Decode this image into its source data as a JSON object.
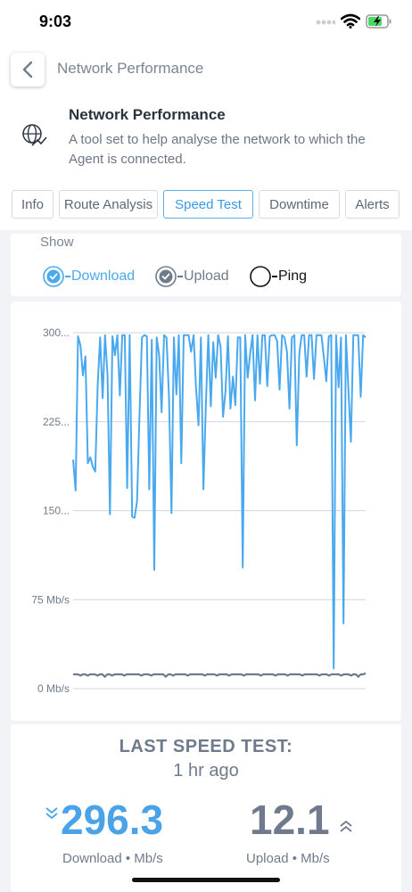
{
  "status_bar": {
    "time": "9:03"
  },
  "nav": {
    "title": "Network Performance"
  },
  "header": {
    "title": "Network Performance",
    "description": "A tool set to help analyse the network to which the Agent is connected."
  },
  "tabs": [
    {
      "label": "Info",
      "active": false
    },
    {
      "label": "Route Analysis",
      "active": false
    },
    {
      "label": "Speed Test",
      "active": true
    },
    {
      "label": "Downtime",
      "active": false
    },
    {
      "label": "Alerts",
      "active": false
    }
  ],
  "show": {
    "label": "Show",
    "toggles": [
      {
        "label": "Download",
        "checked": true
      },
      {
        "label": "Upload",
        "checked": true
      },
      {
        "label": "Ping",
        "checked": false
      }
    ]
  },
  "colors": {
    "download": "#4aa9ee",
    "upload": "#6f7b8c",
    "accent": "#3a9ae6"
  },
  "chart_data": {
    "type": "line",
    "ylim": [
      0,
      300
    ],
    "yticks": [
      {
        "value": 0,
        "label": "0 Mb/s"
      },
      {
        "value": 75,
        "label": "75 Mb/s"
      },
      {
        "value": 150,
        "label": "150..."
      },
      {
        "value": 225,
        "label": "225..."
      },
      {
        "value": 300,
        "label": "300..."
      }
    ],
    "grid": true,
    "series": [
      {
        "name": "Download",
        "values": [
          193,
          167,
          297,
          289,
          264,
          280,
          190,
          195,
          187,
          183,
          257,
          296,
          245,
          298,
          264,
          147,
          297,
          281,
          298,
          247,
          298,
          298,
          169,
          298,
          145,
          144,
          158,
          230,
          296,
          298,
          297,
          168,
          294,
          100,
          296,
          281,
          233,
          298,
          296,
          246,
          148,
          296,
          248,
          298,
          190,
          298,
          298,
          298,
          284,
          298,
          254,
          222,
          296,
          168,
          238,
          298,
          238,
          292,
          262,
          298,
          288,
          229,
          251,
          297,
          236,
          263,
          239,
          296,
          296,
          102,
          298,
          262,
          282,
          298,
          243,
          298,
          257,
          298,
          298,
          255,
          297,
          298,
          298,
          293,
          252,
          298,
          296,
          284,
          236,
          296,
          298,
          205,
          282,
          298,
          298,
          263,
          298,
          298,
          261,
          298,
          298,
          298,
          280,
          259,
          297,
          298,
          17,
          298,
          254,
          296,
          55,
          298,
          252,
          208,
          298,
          298,
          298,
          246,
          298,
          296
        ]
      },
      {
        "name": "Upload",
        "values": [
          12,
          12,
          12,
          11,
          12,
          12,
          11,
          12,
          12,
          12,
          11,
          12,
          12,
          10,
          12,
          12,
          11,
          12,
          12,
          12,
          12,
          11,
          12,
          12,
          12,
          12,
          12,
          12,
          11,
          12,
          12,
          12,
          11,
          12,
          12,
          12,
          12,
          12,
          10,
          12,
          12,
          11,
          12,
          12,
          12,
          12,
          12,
          11,
          12,
          12,
          12,
          12,
          12,
          12,
          11,
          12,
          12,
          12,
          12,
          11,
          12,
          12,
          12,
          12,
          11,
          12,
          12,
          12,
          12,
          12,
          11,
          12,
          12,
          12,
          12,
          12,
          12,
          11,
          12,
          12,
          12,
          12,
          12,
          11,
          12,
          12,
          12,
          12,
          11,
          12,
          12,
          12,
          12,
          12,
          11,
          12,
          12,
          12,
          12,
          12,
          12,
          11,
          12,
          12,
          12,
          11,
          12,
          12,
          12,
          12,
          11,
          12,
          12,
          12,
          11,
          12,
          12,
          10,
          12,
          12,
          13
        ]
      }
    ]
  },
  "summary": {
    "title": "LAST SPEED TEST:",
    "when": "1 hr ago",
    "download_value": "296.3",
    "download_unit": "Download • Mb/s",
    "upload_value": "12.1",
    "upload_unit": "Upload • Mb/s"
  }
}
